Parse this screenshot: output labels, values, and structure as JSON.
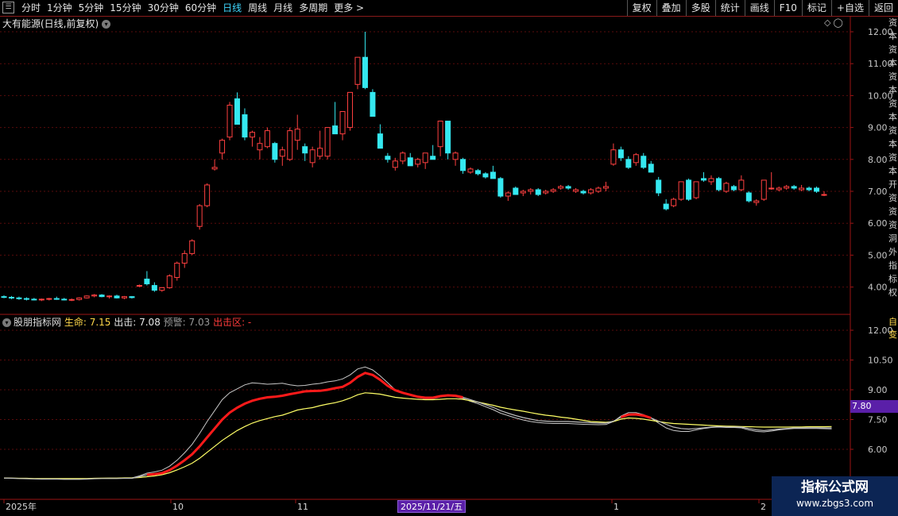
{
  "toolbar": {
    "periods": [
      "分时",
      "1分钟",
      "5分钟",
      "15分钟",
      "30分钟",
      "60分钟",
      "日线",
      "周线",
      "月线",
      "多周期",
      "更多 >"
    ],
    "active_period": "日线",
    "right_items": [
      "复权",
      "叠加",
      "多股",
      "统计",
      "画线",
      "F10",
      "标记",
      "+自选",
      "返回"
    ]
  },
  "main_chart": {
    "title": "大有能源(日线,前复权)",
    "price_ticks": [
      "12.00",
      "11.00",
      "10.00",
      "9.00",
      "8.00",
      "7.00",
      "6.00",
      "5.00",
      "4.00"
    ],
    "side_text": "资本资本资本资本资本资本开资资资洞外指标权"
  },
  "indicator": {
    "name": "股朋指标网",
    "life_label": "生命: 7.15",
    "out_label": "出击: 7.08",
    "warn_label": "预警: 7.03",
    "zone_label": "出击区: -",
    "ticks": [
      "12.00",
      "10.50",
      "9.00",
      "7.50",
      "6.00"
    ],
    "cursor_value": "7.80",
    "side_text": "自变"
  },
  "x_axis": {
    "labels": [
      "2025年",
      "10",
      "11",
      "1",
      "2"
    ],
    "cursor_date": "2025/11/21/五"
  },
  "watermark": {
    "title": "指标公式网",
    "url": "www.zbgs3.com"
  },
  "colors": {
    "up": "#ff4040",
    "down": "#35e8f0",
    "grid": "#5a0b0b",
    "axis": "#9b1414",
    "life_line": "#ffff66",
    "strong_line": "#ff1a1a",
    "white_line": "#c8c8c8",
    "badge": "#5a1fa8"
  },
  "chart_data": {
    "type": "candlestick",
    "ylim": [
      3.4,
      12.4
    ],
    "candles": [
      [
        3.7,
        3.74,
        3.65,
        3.68
      ],
      [
        3.68,
        3.72,
        3.62,
        3.66
      ],
      [
        3.66,
        3.7,
        3.6,
        3.64
      ],
      [
        3.64,
        3.68,
        3.58,
        3.62
      ],
      [
        3.62,
        3.66,
        3.58,
        3.6
      ],
      [
        3.6,
        3.64,
        3.56,
        3.62
      ],
      [
        3.62,
        3.66,
        3.58,
        3.64
      ],
      [
        3.64,
        3.7,
        3.6,
        3.62
      ],
      [
        3.62,
        3.66,
        3.58,
        3.6
      ],
      [
        3.6,
        3.64,
        3.56,
        3.61
      ],
      [
        3.61,
        3.68,
        3.58,
        3.66
      ],
      [
        3.66,
        3.74,
        3.64,
        3.72
      ],
      [
        3.72,
        3.78,
        3.68,
        3.75
      ],
      [
        3.75,
        3.78,
        3.68,
        3.7
      ],
      [
        3.7,
        3.74,
        3.64,
        3.72
      ],
      [
        3.72,
        3.76,
        3.64,
        3.66
      ],
      [
        3.66,
        3.72,
        3.62,
        3.7
      ],
      [
        3.7,
        3.72,
        3.64,
        3.67
      ],
      [
        4.05,
        4.08,
        4.0,
        4.05
      ],
      [
        4.25,
        4.5,
        4.05,
        4.1
      ],
      [
        4.05,
        4.15,
        3.85,
        3.9
      ],
      [
        3.9,
        4.0,
        3.85,
        3.98
      ],
      [
        3.98,
        4.4,
        3.95,
        4.35
      ],
      [
        4.3,
        4.8,
        4.2,
        4.75
      ],
      [
        4.75,
        5.15,
        4.6,
        5.05
      ],
      [
        5.05,
        5.5,
        5.0,
        5.45
      ],
      [
        5.9,
        6.6,
        5.8,
        6.55
      ],
      [
        6.55,
        7.25,
        6.5,
        7.2
      ],
      [
        7.7,
        8.0,
        7.65,
        7.75
      ],
      [
        8.2,
        8.65,
        8.0,
        8.6
      ],
      [
        8.7,
        9.8,
        8.6,
        9.7
      ],
      [
        9.9,
        10.1,
        9.1,
        9.1
      ],
      [
        9.4,
        9.6,
        8.6,
        8.7
      ],
      [
        8.7,
        8.9,
        8.4,
        8.85
      ],
      [
        8.3,
        8.7,
        8.0,
        8.5
      ],
      [
        8.4,
        9.0,
        8.35,
        8.9
      ],
      [
        8.5,
        8.55,
        7.9,
        8.0
      ],
      [
        8.1,
        8.4,
        7.8,
        8.3
      ],
      [
        8.0,
        9.0,
        7.95,
        8.9
      ],
      [
        8.6,
        9.4,
        8.3,
        8.95
      ],
      [
        8.4,
        8.5,
        7.95,
        8.2
      ],
      [
        7.9,
        8.4,
        7.75,
        8.3
      ],
      [
        8.1,
        8.9,
        8.0,
        8.35
      ],
      [
        8.1,
        8.95,
        8.0,
        9.0
      ],
      [
        9.05,
        9.8,
        8.8,
        8.8
      ],
      [
        8.8,
        9.5,
        8.6,
        9.5
      ],
      [
        9.0,
        10.1,
        8.9,
        10.1
      ],
      [
        10.35,
        11.2,
        10.2,
        11.2
      ],
      [
        11.2,
        12.0,
        10.2,
        10.25
      ],
      [
        10.1,
        10.2,
        9.35,
        9.35
      ],
      [
        8.8,
        9.1,
        8.35,
        8.35
      ],
      [
        8.1,
        8.2,
        7.9,
        8.0
      ],
      [
        7.75,
        8.05,
        7.65,
        7.95
      ],
      [
        7.95,
        8.25,
        7.85,
        8.2
      ],
      [
        8.05,
        8.2,
        7.8,
        7.8
      ],
      [
        7.85,
        8.05,
        7.75,
        8.0
      ],
      [
        7.9,
        8.2,
        7.7,
        8.2
      ],
      [
        8.1,
        8.45,
        8.0,
        8.0
      ],
      [
        8.4,
        9.2,
        8.1,
        9.2
      ],
      [
        9.2,
        9.2,
        8.0,
        8.2
      ],
      [
        8.0,
        8.25,
        7.8,
        8.2
      ],
      [
        8.0,
        8.05,
        7.55,
        7.65
      ],
      [
        7.6,
        7.75,
        7.55,
        7.7
      ],
      [
        7.65,
        7.7,
        7.5,
        7.55
      ],
      [
        7.55,
        7.6,
        7.4,
        7.45
      ],
      [
        7.6,
        7.8,
        7.4,
        7.4
      ],
      [
        7.4,
        7.45,
        6.8,
        6.85
      ],
      [
        6.85,
        7.0,
        6.7,
        6.95
      ],
      [
        7.1,
        7.15,
        6.9,
        6.9
      ],
      [
        6.95,
        7.05,
        6.85,
        7.0
      ],
      [
        7.0,
        7.1,
        6.9,
        7.05
      ],
      [
        7.05,
        7.1,
        6.85,
        6.9
      ],
      [
        6.95,
        7.05,
        6.9,
        7.0
      ],
      [
        7.0,
        7.1,
        6.95,
        7.05
      ],
      [
        7.1,
        7.2,
        7.05,
        7.15
      ],
      [
        7.15,
        7.2,
        7.05,
        7.1
      ],
      [
        7.0,
        7.1,
        6.95,
        7.05
      ],
      [
        7.0,
        7.05,
        6.9,
        6.95
      ],
      [
        6.95,
        7.1,
        6.9,
        7.05
      ],
      [
        7.0,
        7.15,
        6.95,
        7.1
      ],
      [
        7.1,
        7.3,
        7.0,
        7.15
      ],
      [
        7.85,
        8.5,
        7.8,
        8.3
      ],
      [
        8.3,
        8.4,
        7.95,
        8.05
      ],
      [
        8.0,
        8.1,
        7.7,
        7.75
      ],
      [
        7.9,
        8.2,
        7.8,
        8.15
      ],
      [
        8.1,
        8.2,
        7.7,
        7.75
      ],
      [
        7.85,
        7.95,
        7.6,
        7.6
      ],
      [
        7.35,
        7.45,
        6.85,
        6.95
      ],
      [
        6.6,
        6.75,
        6.4,
        6.45
      ],
      [
        6.55,
        6.8,
        6.5,
        6.75
      ],
      [
        6.75,
        7.3,
        6.7,
        7.3
      ],
      [
        7.35,
        7.4,
        6.7,
        6.75
      ],
      [
        6.8,
        7.3,
        6.75,
        7.3
      ],
      [
        7.4,
        7.6,
        7.3,
        7.35
      ],
      [
        7.3,
        7.5,
        7.2,
        7.4
      ],
      [
        7.4,
        7.45,
        7.0,
        7.05
      ],
      [
        7.0,
        7.3,
        6.95,
        7.25
      ],
      [
        7.15,
        7.2,
        7.0,
        7.05
      ],
      [
        7.05,
        7.5,
        7.0,
        7.35
      ],
      [
        6.95,
        7.0,
        6.65,
        6.7
      ],
      [
        6.65,
        6.75,
        6.55,
        6.7
      ],
      [
        6.75,
        7.35,
        6.7,
        7.35
      ],
      [
        7.1,
        7.6,
        7.05,
        7.1
      ],
      [
        7.05,
        7.15,
        7.0,
        7.1
      ],
      [
        7.1,
        7.2,
        7.05,
        7.15
      ],
      [
        7.15,
        7.2,
        7.05,
        7.1
      ],
      [
        7.05,
        7.2,
        7.0,
        7.1
      ],
      [
        7.1,
        7.15,
        7.0,
        7.05
      ],
      [
        7.1,
        7.15,
        6.95,
        7.0
      ],
      [
        6.9,
        7.0,
        6.85,
        6.9
      ]
    ],
    "indicator_ylim": [
      4.2,
      13.2
    ],
    "indicator_series": [
      {
        "name": "生命",
        "values": [
          4.55,
          4.55,
          4.54,
          4.54,
          4.53,
          4.53,
          4.53,
          4.53,
          4.53,
          4.53,
          4.53,
          4.53,
          4.54,
          4.55,
          4.55,
          4.55,
          4.56,
          4.56,
          4.58,
          4.62,
          4.66,
          4.72,
          4.82,
          4.96,
          5.12,
          5.3,
          5.55,
          5.85,
          6.15,
          6.45,
          6.7,
          6.95,
          7.15,
          7.32,
          7.45,
          7.55,
          7.65,
          7.72,
          7.85,
          7.98,
          8.05,
          8.1,
          8.2,
          8.28,
          8.35,
          8.45,
          8.58,
          8.75,
          8.85,
          8.82,
          8.78,
          8.7,
          8.62,
          8.58,
          8.55,
          8.52,
          8.5,
          8.5,
          8.52,
          8.55,
          8.55,
          8.52,
          8.45,
          8.38,
          8.3,
          8.22,
          8.12,
          8.05,
          7.98,
          7.92,
          7.85,
          7.78,
          7.72,
          7.68,
          7.62,
          7.58,
          7.52,
          7.46,
          7.4,
          7.38,
          7.36,
          7.4,
          7.52,
          7.58,
          7.56,
          7.52,
          7.46,
          7.4,
          7.34,
          7.3,
          7.28,
          7.26,
          7.24,
          7.22,
          7.2,
          7.18,
          7.17,
          7.16,
          7.15,
          7.14,
          7.13,
          7.12,
          7.12,
          7.12,
          7.12,
          7.13,
          7.13,
          7.14,
          7.14,
          7.14,
          7.15
        ]
      },
      {
        "name": "出击",
        "values": [
          4.55,
          4.54,
          4.53,
          4.52,
          4.51,
          4.5,
          4.5,
          4.5,
          4.49,
          4.49,
          4.49,
          4.5,
          4.52,
          4.53,
          4.53,
          4.53,
          4.54,
          4.54,
          4.62,
          4.72,
          4.75,
          4.8,
          4.95,
          5.18,
          5.45,
          5.75,
          6.15,
          6.6,
          7.05,
          7.5,
          7.85,
          8.1,
          8.3,
          8.45,
          8.55,
          8.62,
          8.65,
          8.7,
          8.78,
          8.85,
          8.92,
          8.94,
          8.95,
          9.0,
          9.08,
          9.15,
          9.35,
          9.65,
          9.85,
          9.75,
          9.5,
          9.2,
          8.98,
          8.85,
          8.75,
          8.65,
          8.6,
          8.6,
          8.68,
          8.72,
          8.7,
          8.62,
          8.5,
          8.38,
          8.25,
          8.12,
          7.95,
          7.82,
          7.7,
          7.6,
          7.52,
          7.45,
          7.42,
          7.4,
          7.4,
          7.4,
          7.38,
          7.36,
          7.34,
          7.32,
          7.32,
          7.42,
          7.62,
          7.75,
          7.76,
          7.7,
          7.58,
          7.42,
          7.26,
          7.12,
          7.05,
          7.02,
          7.05,
          7.08,
          7.12,
          7.14,
          7.12,
          7.12,
          7.12,
          7.05,
          6.98,
          6.95,
          6.98,
          7.02,
          7.05,
          7.08,
          7.08,
          7.09,
          7.09,
          7.08,
          7.08
        ]
      },
      {
        "name": "预警",
        "values": [
          4.56,
          4.55,
          4.54,
          4.53,
          4.52,
          4.51,
          4.51,
          4.51,
          4.5,
          4.5,
          4.5,
          4.51,
          4.53,
          4.54,
          4.55,
          4.55,
          4.56,
          4.56,
          4.66,
          4.8,
          4.86,
          4.95,
          5.15,
          5.45,
          5.82,
          6.25,
          6.8,
          7.4,
          7.95,
          8.5,
          8.85,
          9.05,
          9.25,
          9.35,
          9.32,
          9.28,
          9.3,
          9.33,
          9.25,
          9.2,
          9.22,
          9.28,
          9.32,
          9.4,
          9.45,
          9.55,
          9.75,
          10.05,
          10.15,
          10.0,
          9.7,
          9.35,
          9.0,
          8.82,
          8.72,
          8.62,
          8.55,
          8.55,
          8.64,
          8.7,
          8.66,
          8.56,
          8.42,
          8.3,
          8.15,
          8.0,
          7.82,
          7.7,
          7.58,
          7.48,
          7.4,
          7.35,
          7.32,
          7.3,
          7.3,
          7.3,
          7.28,
          7.26,
          7.25,
          7.24,
          7.25,
          7.4,
          7.68,
          7.85,
          7.85,
          7.75,
          7.58,
          7.32,
          7.08,
          6.95,
          6.9,
          6.9,
          6.98,
          7.05,
          7.1,
          7.12,
          7.1,
          7.1,
          7.08,
          6.98,
          6.9,
          6.88,
          6.92,
          6.98,
          7.02,
          7.05,
          7.05,
          7.05,
          7.05,
          7.04,
          7.03
        ]
      }
    ]
  }
}
